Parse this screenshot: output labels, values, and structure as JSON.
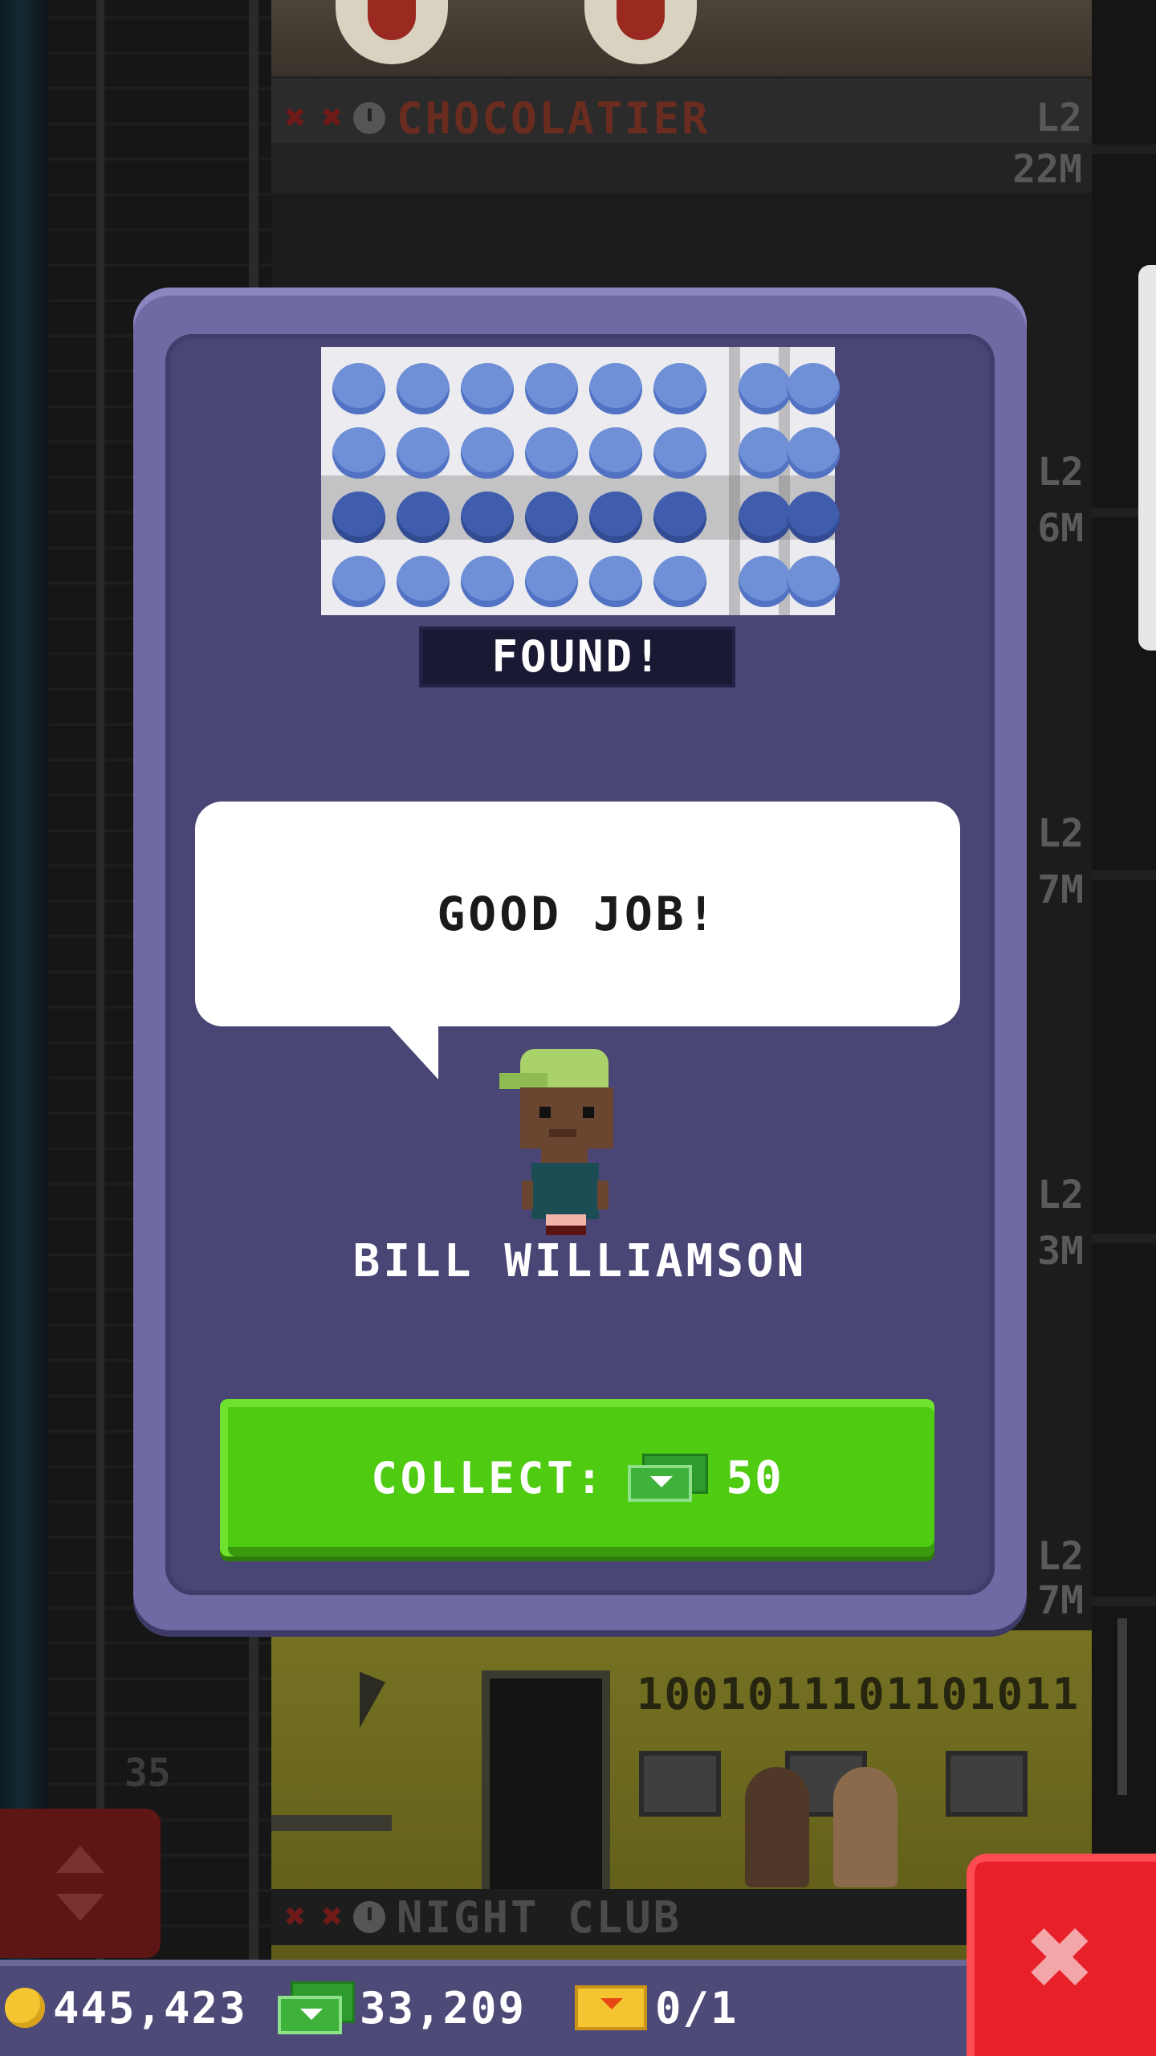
{
  "tower": {
    "top_floor": {
      "name": "CHOCOLATIER",
      "level": "L2",
      "value": "22M"
    },
    "side_levels": [
      {
        "level": "L2",
        "value": "6M"
      },
      {
        "level": "L2",
        "value": "7M"
      },
      {
        "level": "L2",
        "value": "3M"
      },
      {
        "level": "L2",
        "value": "7M"
      }
    ],
    "code_floor": {
      "binary_text": "1001011101101011"
    },
    "floor_number": "35",
    "bottom_floor": {
      "name": "NIGHT CLUB"
    }
  },
  "modal": {
    "found_label": "FOUND!",
    "speech_text": "GOOD JOB!",
    "person_name": "BILL WILLIAMSON",
    "collect": {
      "label": "COLLECT:",
      "amount": "50",
      "icon": "bux-icon"
    }
  },
  "bottom_bar": {
    "coins": "445,423",
    "bux": "33,209",
    "tickets": "0/1",
    "icons": [
      "coin-icon",
      "bux-icon",
      "golden-ticket-icon"
    ]
  },
  "close_button": {
    "icon": "close-icon"
  },
  "colors": {
    "modal_frame": "#6e6aa4",
    "modal_inner": "#494675",
    "collect_green": "#4fcb12",
    "close_red": "#e8202a",
    "bottom_bar": "#4d4a78"
  }
}
